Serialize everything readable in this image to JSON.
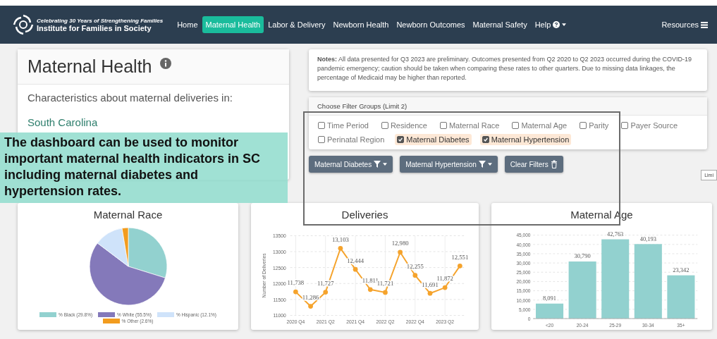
{
  "navbar": {
    "logo_tagline": "Celebrating 30 Years of Strengthening Families",
    "logo_name": "Institute for Families in Society",
    "items": [
      {
        "label": "Home",
        "selected": false
      },
      {
        "label": "Maternal Health",
        "selected": true
      },
      {
        "label": "Labor & Delivery",
        "selected": false
      },
      {
        "label": "Newborn Health",
        "selected": false
      },
      {
        "label": "Newborn Outcomes",
        "selected": false
      },
      {
        "label": "Maternal Safety",
        "selected": false
      }
    ],
    "help": "Help",
    "resources": "Resources"
  },
  "summary": {
    "title": "Maternal Health",
    "subtitle": "Characteristics about maternal deliveries in:",
    "region": "South Carolina"
  },
  "notes": "**Notes:** All data presented for Q3 2023 are preliminary. Outcomes presented from Q2 2020 to Q2 2023 occurred during the COVID-19 pandemic emergency; caution should be taken when comparing these rates to other quarters. Due to missing data linkages, the percentage of Medicaid may be higher than reported.",
  "filters": {
    "title": "Choose Filter Groups (Limit 2)",
    "options": [
      {
        "label": "Time Period",
        "checked": false
      },
      {
        "label": "Residence",
        "checked": false
      },
      {
        "label": "Maternal Race",
        "checked": false
      },
      {
        "label": "Maternal Age",
        "checked": false
      },
      {
        "label": "Parity",
        "checked": false
      },
      {
        "label": "Payer Source",
        "checked": false
      },
      {
        "label": "Perinatal Region",
        "checked": false
      },
      {
        "label": "Maternal Diabetes",
        "checked": true
      },
      {
        "label": "Maternal Hypertension",
        "checked": true
      }
    ]
  },
  "filter_buttons": [
    {
      "label": "Maternal Diabetes",
      "kind": "filter"
    },
    {
      "label": "Maternal Hypertension",
      "kind": "filter"
    },
    {
      "label": "Clear Filters",
      "kind": "clear"
    }
  ],
  "tooltip": "Limi",
  "callout": "The dashboard can be used to monitor important maternal health indicators in SC including maternal diabetes and hypertension rates.",
  "charts": [
    {
      "title": "Maternal Race",
      "chart_data": {
        "type": "pie",
        "categories": [
          "% Black (29.8%)",
          "% White (55.5%)",
          "% Hispanic (12.1%)",
          "% Other (2.6%)"
        ],
        "values": [
          29.8,
          55.5,
          12.1,
          2.6
        ],
        "colors": [
          "#92d1cf",
          "#8479ba",
          "#cfe3fa",
          "#f29c1f"
        ]
      }
    },
    {
      "title": "Deliveries",
      "chart_data": {
        "type": "line",
        "ylabel": "Number of Deliveries",
        "categories": [
          "2020 Q4",
          null,
          "2021 Q2",
          null,
          "2021 Q4",
          null,
          "2022 Q2",
          null,
          "2022 Q4",
          null,
          "2023 Q2",
          null
        ],
        "color": "#f5a32c",
        "values": [
          11738,
          11286,
          11727,
          13103,
          12444,
          11811,
          11721,
          12980,
          12255,
          11691,
          11872,
          12551
        ],
        "value_labels": [
          "11,738",
          "11,286",
          "11,727",
          "13,103",
          "12,444",
          "11,811",
          "11,721",
          "12,980",
          "12,255",
          "11,691",
          "11,872",
          "12,551"
        ],
        "ylim": [
          11000,
          13500
        ],
        "yticks": [
          11000,
          11500,
          12000,
          12500,
          13000,
          13500
        ],
        "grid": true,
        "marker": true
      }
    },
    {
      "title": "Maternal Age",
      "chart_data": {
        "type": "bar",
        "categories": [
          "<20",
          "20-24",
          "25-29",
          "30-34",
          "35+"
        ],
        "color": "#92d1cf",
        "values": [
          8091,
          30790,
          42763,
          40193,
          23342
        ],
        "value_labels": [
          "8,091",
          "30,790",
          "42,763",
          "40,193",
          "23,342"
        ],
        "ylim": [
          0,
          45000
        ],
        "yticks": [
          {
            "value": 0,
            "label": "0"
          },
          {
            "value": 5000,
            "label": "5,000"
          },
          {
            "value": 10000,
            "label": "10,000"
          },
          {
            "value": 15000,
            "label": "15,000"
          },
          {
            "value": 20000,
            "label": "20,000"
          },
          {
            "value": 25000,
            "label": "25,000"
          },
          {
            "value": 30000,
            "label": "30,000"
          },
          {
            "value": 35000,
            "label": "35,000"
          },
          {
            "value": 40000,
            "label": "40,000"
          },
          {
            "value": 45000,
            "label": "45,000"
          }
        ],
        "grid": true
      }
    }
  ]
}
